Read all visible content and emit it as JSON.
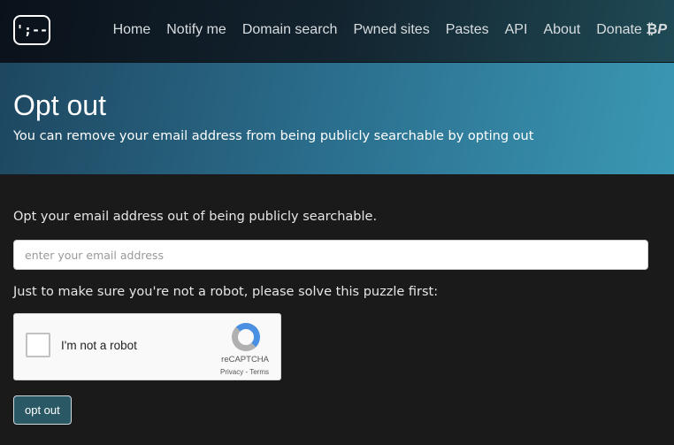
{
  "nav": {
    "logo": "';--",
    "links": [
      "Home",
      "Notify me",
      "Domain search",
      "Pwned sites",
      "Pastes",
      "API",
      "About",
      "Donate"
    ],
    "donate_icons": [
      "bitcoin-icon",
      "paypal-icon"
    ]
  },
  "hero": {
    "title": "Opt out",
    "subtitle": "You can remove your email address from being publicly searchable by opting out"
  },
  "main": {
    "intro": "Opt your email address out of being publicly searchable.",
    "email_placeholder": "enter your email address",
    "email_value": "",
    "robot_prompt": "Just to make sure you're not a robot, please solve this puzzle first:",
    "captcha": {
      "label": "I'm not a robot",
      "brand": "reCAPTCHA",
      "links": "Privacy - Terms",
      "checked": false
    },
    "submit": "opt out"
  }
}
